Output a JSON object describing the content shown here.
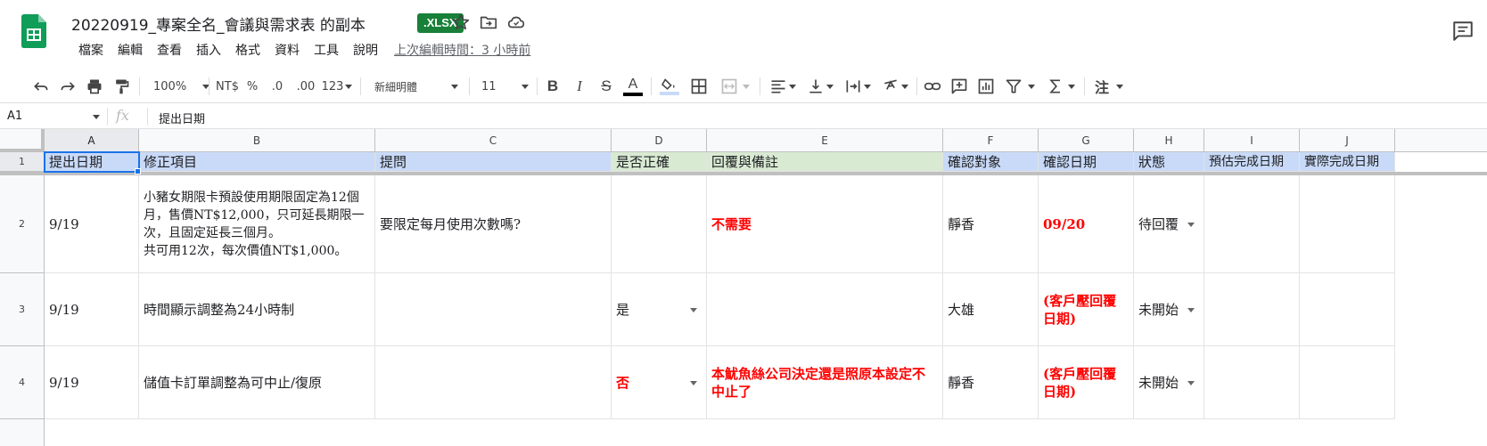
{
  "app": {
    "doc_title": "20220919_專案全名_會議與需求表 的副本",
    "badge": ".XLSX",
    "menu": [
      "檔案",
      "編輯",
      "查看",
      "插入",
      "格式",
      "資料",
      "工具",
      "說明"
    ],
    "last_edit": "上次編輯時間：3 小時前"
  },
  "toolbar": {
    "zoom": "100%",
    "currency": "NT$",
    "percent": "%",
    "dec_decrease": ".0",
    "dec_increase": ".00",
    "number_format": "123",
    "font": "新細明體",
    "font_size": "11",
    "bold": "B",
    "italic": "I",
    "strike": "S",
    "text_color": "A",
    "comment_label": "注"
  },
  "formula_bar": {
    "name_box": "A1",
    "fx": "fx",
    "value": "提出日期"
  },
  "columns": [
    "A",
    "B",
    "C",
    "D",
    "E",
    "F",
    "G",
    "H",
    "I",
    "J"
  ],
  "row_numbers": [
    "1",
    "2",
    "3",
    "4"
  ],
  "header_row": [
    "提出日期",
    "修正項目",
    "提問",
    "是否正確",
    "回覆與備註",
    "確認對象",
    "確認日期",
    "狀態",
    "預估完成日期",
    "實際完成日期"
  ],
  "rows": [
    {
      "A": "9/19",
      "B": "小豬女期限卡預設使用期限固定為12個月，售價NT$12,000，只可延長期限一次，且固定延長三個月。\n共可用12次，每次價值NT$1,000。",
      "C": "要限定每月使用次數嗎?",
      "D": "",
      "E": "不需要",
      "F": "靜香",
      "G": "09/20",
      "H": "待回覆",
      "I": "",
      "J": ""
    },
    {
      "A": "9/19",
      "B": "時間顯示調整為24小時制",
      "C": "",
      "D": "是",
      "E": "",
      "F": "大雄",
      "G": "(客戶壓回覆日期)",
      "H": "未開始",
      "I": "",
      "J": ""
    },
    {
      "A": "9/19",
      "B": "儲值卡訂單調整為可中止/復原",
      "C": "",
      "D": "否",
      "E": "本魷魚絲公司決定還是照原本設定不中止了",
      "F": "靜香",
      "G": "(客戶壓回覆日期)",
      "H": "未開始",
      "I": "",
      "J": ""
    }
  ],
  "colors": {
    "header_blue": "#c9daf8",
    "header_green": "#d9ead3",
    "red_text": "#ff0000",
    "badge_green": "#188038",
    "selection": "#1a73e8"
  }
}
